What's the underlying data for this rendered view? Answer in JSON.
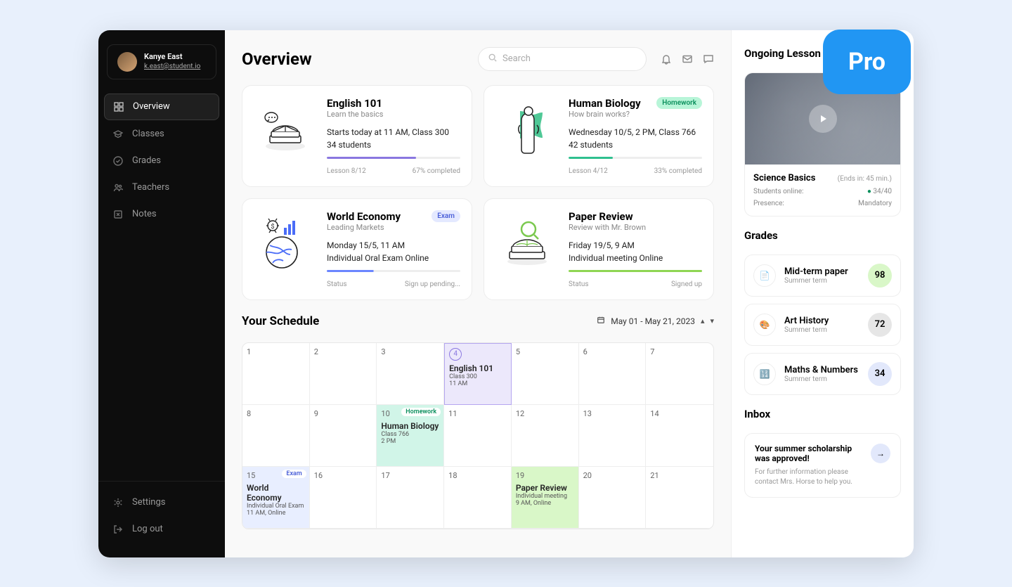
{
  "badge": "Pro",
  "sidebar": {
    "user": {
      "name": "Kanye East",
      "email": "k.east@student.io"
    },
    "nav": [
      {
        "label": "Overview",
        "icon": "grid"
      },
      {
        "label": "Classes",
        "icon": "cap"
      },
      {
        "label": "Grades",
        "icon": "check-circle"
      },
      {
        "label": "Teachers",
        "icon": "people"
      },
      {
        "label": "Notes",
        "icon": "note"
      }
    ],
    "bottom": [
      {
        "label": "Settings",
        "icon": "gear"
      },
      {
        "label": "Log out",
        "icon": "logout"
      }
    ]
  },
  "header": {
    "title": "Overview",
    "search_placeholder": "Search"
  },
  "cards": [
    {
      "title": "English 101",
      "subtitle": "Learn the basics",
      "line1": "Starts today at 11 AM, Class 300",
      "line2": "34 students",
      "progress_label": "Lesson 8/12",
      "progress_pct": "67% completed",
      "pct": 67,
      "color": "#8a77e0",
      "badge": null
    },
    {
      "title": "Human Biology",
      "subtitle": "How brain works?",
      "line1": "Wednesday 10/5, 2 PM, Class 766",
      "line2": "42 students",
      "progress_label": "Lesson 4/12",
      "progress_pct": "33% completed",
      "pct": 33,
      "color": "#2fc08f",
      "badge": {
        "text": "Homework",
        "class": "badge-hw"
      }
    },
    {
      "title": "World Economy",
      "subtitle": "Leading Markets",
      "line1": "Monday 15/5, 11 AM",
      "line2": "Individual Oral Exam Online",
      "status_label": "Status",
      "status_value": "Sign up pending...",
      "color": "#6b86ff",
      "pct": 35,
      "badge": {
        "text": "Exam",
        "class": "badge-exam"
      }
    },
    {
      "title": "Paper Review",
      "subtitle": "Review with Mr. Brown",
      "line1": "Friday 19/5, 9 AM",
      "line2": "Individual meeting Online",
      "status_label": "Status",
      "status_value": "Signed up",
      "color": "#8fd653",
      "pct": 100,
      "badge": null
    }
  ],
  "schedule": {
    "title": "Your Schedule",
    "range": "May 01 - May 21, 2023",
    "cells": [
      {
        "num": "1"
      },
      {
        "num": "2"
      },
      {
        "num": "3"
      },
      {
        "num": "4",
        "class": "cell-purple",
        "circled": true,
        "event": {
          "title": "English 101",
          "sub1": "Class 300",
          "sub2": "11 AM"
        }
      },
      {
        "num": "5"
      },
      {
        "num": "6"
      },
      {
        "num": "7"
      },
      {
        "num": "8"
      },
      {
        "num": "9"
      },
      {
        "num": "10",
        "class": "cell-teal",
        "badge": {
          "text": "Homework",
          "class": "hw"
        },
        "event": {
          "title": "Human Biology",
          "sub1": "Class 766",
          "sub2": "2 PM"
        }
      },
      {
        "num": "11"
      },
      {
        "num": "12"
      },
      {
        "num": "13"
      },
      {
        "num": "14"
      },
      {
        "num": "15",
        "class": "cell-blue",
        "badge": {
          "text": "Exam",
          "class": "exam"
        },
        "event": {
          "title": "World Economy",
          "sub1": "Individual Oral Exam",
          "sub2": "11 AM, Online"
        }
      },
      {
        "num": "16"
      },
      {
        "num": "17"
      },
      {
        "num": "18"
      },
      {
        "num": "19",
        "class": "cell-green",
        "event": {
          "title": "Paper Review",
          "sub1": "Individual meeting",
          "sub2": "9 AM, Online"
        }
      },
      {
        "num": "20"
      },
      {
        "num": "21"
      }
    ]
  },
  "ongoing": {
    "heading": "Ongoing Lesson",
    "name": "Science Basics",
    "ends": "(Ends in: 45 min.)",
    "row1_label": "Students online:",
    "row1_value": "34/40",
    "row2_label": "Presence:",
    "row2_value": "Mandatory"
  },
  "grades": {
    "heading": "Grades",
    "items": [
      {
        "name": "Mid-term paper",
        "term": "Summer term",
        "score": "98",
        "class": "sc-green"
      },
      {
        "name": "Art History",
        "term": "Summer term",
        "score": "72",
        "class": "sc-grey"
      },
      {
        "name": "Maths & Numbers",
        "term": "Summer term",
        "score": "34",
        "class": "sc-blue"
      }
    ]
  },
  "inbox": {
    "heading": "Inbox",
    "title": "Your summer scholarship was approved!",
    "sub": "For further information please contact Mrs. Horse to help you."
  }
}
